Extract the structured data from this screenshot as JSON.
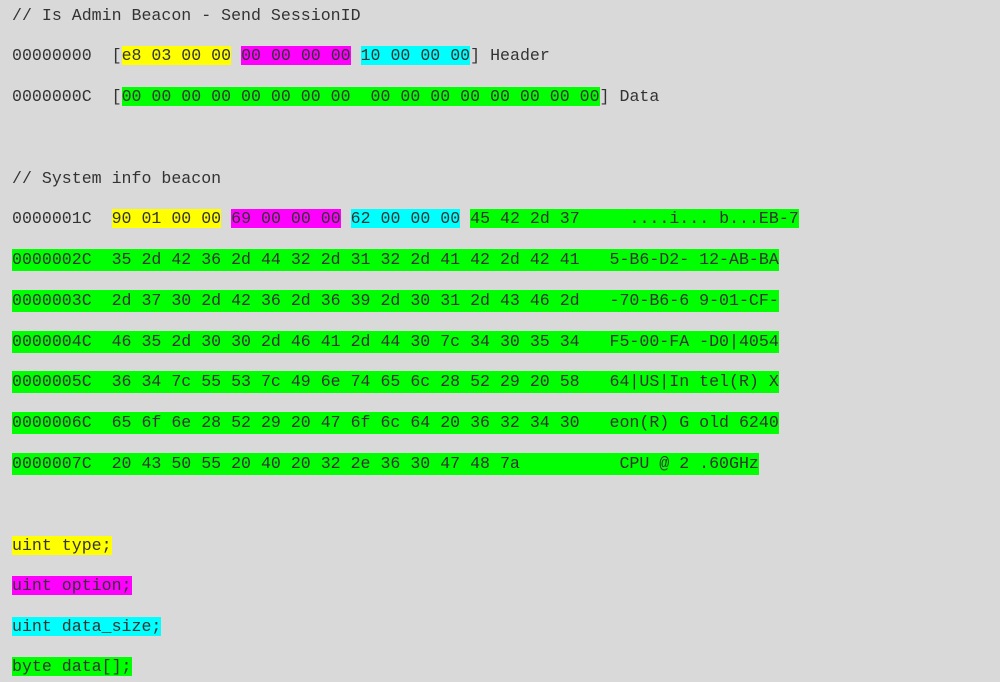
{
  "colors": {
    "background": "#d9d9d9",
    "text": "#333333",
    "type_highlight": "#ffff00",
    "option_highlight": "#ff00ff",
    "data_size_highlight": "#00ffff",
    "data_highlight": "#00ff00"
  },
  "admin_beacon": {
    "comment": "// Is Admin Beacon - Send SessionID",
    "header_row": {
      "offset": "00000000",
      "open_bracket": "[",
      "type_bytes": "e8 03 00 00",
      "option_bytes": "00 00 00 00",
      "data_size_bytes": "10 00 00 00",
      "close_bracket": "]",
      "label": "Header"
    },
    "data_row": {
      "offset": "0000000C",
      "open_bracket": "[",
      "data_bytes": "00 00 00 00 00 00 00 00  00 00 00 00 00 00 00 00",
      "close_bracket": "]",
      "label": "Data"
    }
  },
  "system_info": {
    "comment": "// System info beacon",
    "first_row": {
      "offset": "0000001C",
      "type_bytes": "90 01 00 00",
      "option_bytes": "69 00 00 00",
      "data_size_bytes": "62 00 00 00",
      "data_bytes": "45 42 2d 37",
      "ascii": "....i... b...EB-7"
    },
    "rows": [
      {
        "offset": "0000002C",
        "hex": "35 2d 42 36 2d 44 32 2d 31 32 2d 41 42 2d 42 41",
        "ascii": "5-B6-D2- 12-AB-BA"
      },
      {
        "offset": "0000003C",
        "hex": "2d 37 30 2d 42 36 2d 36 39 2d 30 31 2d 43 46 2d",
        "ascii": "-70-B6-6 9-01-CF-"
      },
      {
        "offset": "0000004C",
        "hex": "46 35 2d 30 30 2d 46 41 2d 44 30 7c 34 30 35 34",
        "ascii": "F5-00-FA -D0|4054"
      },
      {
        "offset": "0000005C",
        "hex": "36 34 7c 55 53 7c 49 6e 74 65 6c 28 52 29 20 58",
        "ascii": "64|US|In tel(R) X"
      },
      {
        "offset": "0000006C",
        "hex": "65 6f 6e 28 52 29 20 47 6f 6c 64 20 36 32 34 30",
        "ascii": "eon(R) G old 6240"
      },
      {
        "offset": "0000007C",
        "hex": "20 43 50 55 20 40 20 32 2e 36 30 47 48 7a",
        "ascii": " CPU @ 2 .60GHz"
      }
    ]
  },
  "legend": {
    "type": "uint type;",
    "option": "uint option;",
    "data_size": "uint data_size;",
    "data": "byte data[];"
  }
}
